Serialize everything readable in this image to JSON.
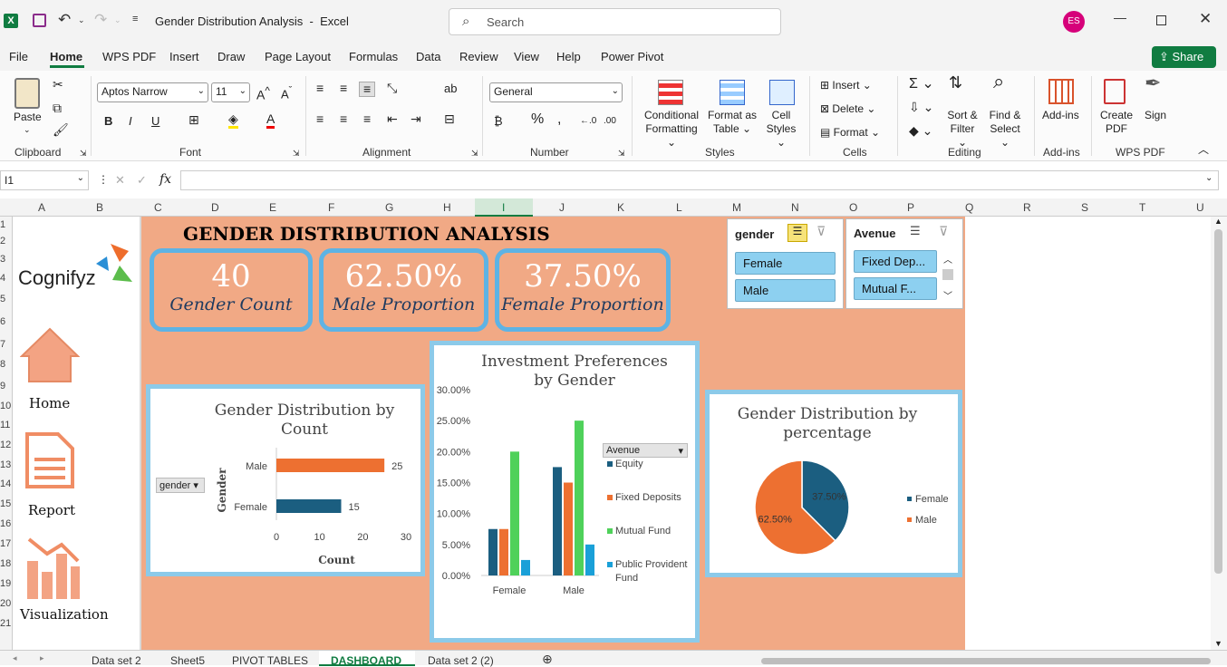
{
  "window": {
    "title": "Gender Distribution Analysis  -  Excel",
    "search_placeholder": "Search",
    "user_initials": "ES"
  },
  "menu": [
    "File",
    "Home",
    "WPS PDF",
    "Insert",
    "Draw",
    "Page Layout",
    "Formulas",
    "Data",
    "Review",
    "View",
    "Help",
    "Power Pivot"
  ],
  "share_label": "Share",
  "ribbon": {
    "paste": "Paste",
    "font_name": "Aptos Narrow",
    "font_size": "11",
    "number_format": "General",
    "conditional": "Conditional",
    "formatting": "Formatting",
    "format_as": "Format as",
    "table": "Table",
    "cell": "Cell",
    "styles_btn": "Styles",
    "insert": "Insert",
    "delete": "Delete",
    "format": "Format",
    "sort": "Sort &",
    "filter": "Filter",
    "find": "Find &",
    "select": "Select",
    "addins": "Add-ins",
    "create": "Create",
    "pdf": "PDF",
    "sign": "Sign",
    "groups": {
      "clipboard": "Clipboard",
      "font": "Font",
      "alignment": "Alignment",
      "number": "Number",
      "styles": "Styles",
      "cells": "Cells",
      "editing": "Editing",
      "addins": "Add-ins",
      "wpspdf": "WPS PDF"
    }
  },
  "formula": {
    "namebox": "I1",
    "fx": "fx"
  },
  "columns": [
    "A",
    "B",
    "C",
    "D",
    "E",
    "F",
    "G",
    "H",
    "I",
    "J",
    "K",
    "L",
    "M",
    "N",
    "O",
    "P",
    "Q",
    "R",
    "S",
    "T",
    "U"
  ],
  "rows": [
    "1",
    "2",
    "3",
    "4",
    "5",
    "6",
    "7",
    "8",
    "9",
    "10",
    "11",
    "12",
    "13",
    "14",
    "15",
    "16",
    "17",
    "18",
    "19",
    "20",
    "21"
  ],
  "sidebar": {
    "brand": "Cognifyz",
    "home": "Home",
    "report": "Report",
    "visualization": "Visualization"
  },
  "dashboard": {
    "title": "GENDER DISTRIBUTION ANALYSIS",
    "kpis": [
      {
        "value": "40",
        "label": "Gender Count"
      },
      {
        "value": "62.50%",
        "label": "Male Proportion"
      },
      {
        "value": "37.50%",
        "label": "Female Proportion"
      }
    ]
  },
  "slicers": {
    "gender": {
      "title": "gender",
      "items": [
        "Female",
        "Male"
      ]
    },
    "avenue": {
      "title": "Avenue",
      "items": [
        "Fixed Dep...",
        "Mutual F..."
      ]
    }
  },
  "colors": {
    "blue": "#1b5e80",
    "orange": "#ed7031",
    "green": "#4fd15a",
    "cyan": "#1aa0d8",
    "accent": "#f1a985",
    "border": "#5eb3e4"
  },
  "chart_data": [
    {
      "type": "bar",
      "title": "Gender Distribution by Count",
      "categories": [
        "Male",
        "Female"
      ],
      "values": [
        25,
        15
      ],
      "colors": [
        "#ed7031",
        "#1b5e80"
      ],
      "xlabel": "Count",
      "ylabel": "Gender",
      "xlim": [
        0,
        30
      ],
      "ticks": [
        "0",
        "10",
        "20",
        "30"
      ],
      "filter_label": "gender"
    },
    {
      "type": "bar",
      "title": "Investment Preferences by Gender",
      "categories": [
        "Female",
        "Male"
      ],
      "series": [
        {
          "name": "Equity",
          "values": [
            0.075,
            0.175
          ]
        },
        {
          "name": "Fixed Deposits",
          "values": [
            0.075,
            0.15
          ]
        },
        {
          "name": "Mutual Fund",
          "values": [
            0.2,
            0.25
          ]
        },
        {
          "name": "Public Provident Fund",
          "values": [
            0.025,
            0.05
          ]
        }
      ],
      "ylim": [
        0,
        0.3
      ],
      "yticks": [
        "0.00%",
        "5.00%",
        "10.00%",
        "15.00%",
        "20.00%",
        "25.00%",
        "30.00%"
      ],
      "legend_title": "Avenue"
    },
    {
      "type": "pie",
      "title": "Gender Distribution by percentage",
      "labels": [
        "Female",
        "Male"
      ],
      "values": [
        37.5,
        62.5
      ],
      "data_labels": [
        "37.50%",
        "62.50%"
      ],
      "colors": [
        "#1b5e80",
        "#ed7031"
      ],
      "legend": "right"
    }
  ],
  "tabs": [
    "Data set 2",
    "Sheet5",
    "PIVOT TABLES",
    "DASHBOARD",
    "Data set 2 (2)"
  ]
}
